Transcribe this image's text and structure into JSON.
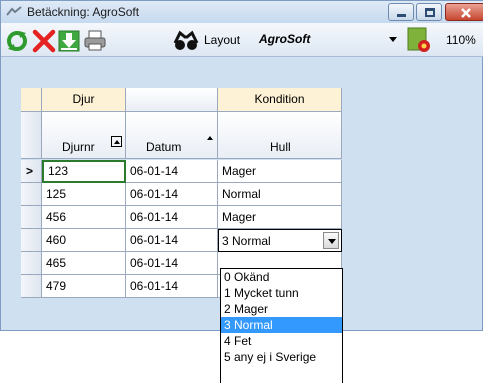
{
  "window": {
    "title": "Betäckning: AgroSoft"
  },
  "toolbar": {
    "layout_label": "Layout",
    "layout_value": "AgroSoft",
    "zoom": "110%"
  },
  "grid": {
    "group_headers": [
      "Djur",
      "",
      "Kondition"
    ],
    "columns": [
      "Djurnr",
      "Datum",
      "Hull"
    ],
    "rows": [
      {
        "djurnr": "123",
        "datum": "06-01-14",
        "hull": "Mager",
        "current": true
      },
      {
        "djurnr": "125",
        "datum": "06-01-14",
        "hull": "Normal",
        "current": false
      },
      {
        "djurnr": "456",
        "datum": "06-01-14",
        "hull": "Mager",
        "current": false
      },
      {
        "djurnr": "460",
        "datum": "06-01-14",
        "hull": "3 Normal",
        "current": false
      },
      {
        "djurnr": "465",
        "datum": "06-01-14",
        "hull": "",
        "current": false
      },
      {
        "djurnr": "479",
        "datum": "06-01-14",
        "hull": "",
        "current": false
      }
    ],
    "current_row_marker": ">"
  },
  "dropdown": {
    "options": [
      "0 Okänd",
      "1 Mycket tunn",
      "2 Mager",
      "3 Normal",
      "4 Fet",
      "5 any ej i Sverige"
    ],
    "selected_index": 3
  },
  "colors": {
    "selected_option": "#3399ff",
    "group_header": "#fdf2d6",
    "background": "#cfe0f1"
  }
}
